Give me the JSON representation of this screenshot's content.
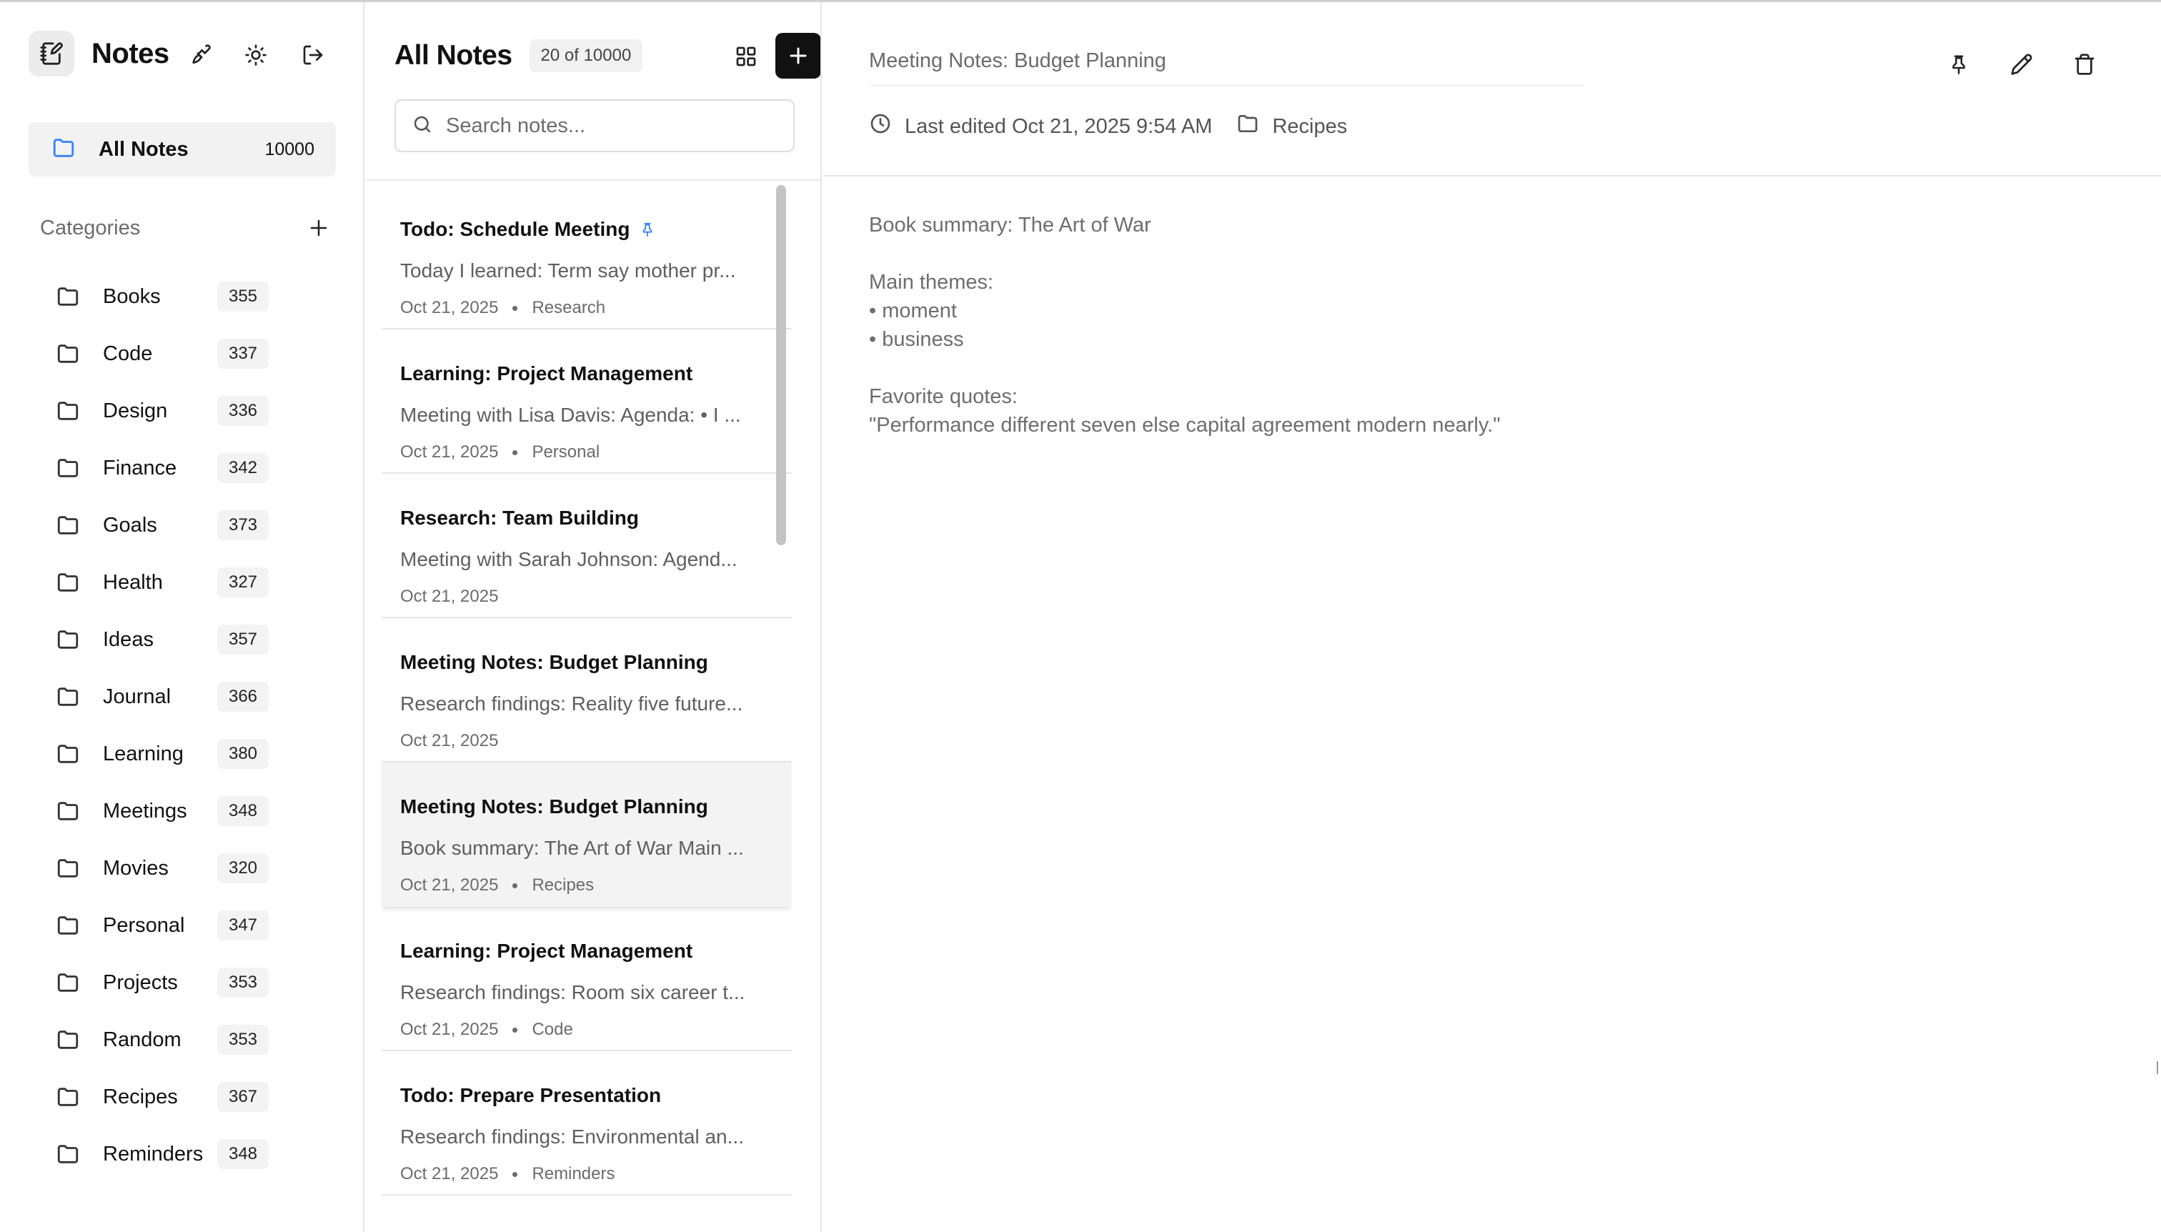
{
  "app": {
    "title": "Notes"
  },
  "sidebar": {
    "all_notes": {
      "label": "All Notes",
      "count": "10000"
    },
    "categories_title": "Categories",
    "categories": [
      {
        "name": "Books",
        "count": "355"
      },
      {
        "name": "Code",
        "count": "337"
      },
      {
        "name": "Design",
        "count": "336"
      },
      {
        "name": "Finance",
        "count": "342"
      },
      {
        "name": "Goals",
        "count": "373"
      },
      {
        "name": "Health",
        "count": "327"
      },
      {
        "name": "Ideas",
        "count": "357"
      },
      {
        "name": "Journal",
        "count": "366"
      },
      {
        "name": "Learning",
        "count": "380"
      },
      {
        "name": "Meetings",
        "count": "348"
      },
      {
        "name": "Movies",
        "count": "320"
      },
      {
        "name": "Personal",
        "count": "347"
      },
      {
        "name": "Projects",
        "count": "353"
      },
      {
        "name": "Random",
        "count": "353"
      },
      {
        "name": "Recipes",
        "count": "367"
      },
      {
        "name": "Reminders",
        "count": "348"
      }
    ]
  },
  "list": {
    "title": "All Notes",
    "count_label": "20 of 10000",
    "search_placeholder": "Search notes...",
    "notes": [
      {
        "title": "Todo: Schedule Meeting",
        "preview": "Today I learned: Term say mother pr...",
        "date": "Oct 21, 2025",
        "category": "Research",
        "pinned": true
      },
      {
        "title": "Learning: Project Management",
        "preview": "Meeting with Lisa Davis: Agenda: • I ...",
        "date": "Oct 21, 2025",
        "category": "Personal"
      },
      {
        "title": "Research: Team Building",
        "preview": "Meeting with Sarah Johnson: Agend...",
        "date": "Oct 21, 2025",
        "category": ""
      },
      {
        "title": "Meeting Notes: Budget Planning",
        "preview": "Research findings: Reality five future...",
        "date": "Oct 21, 2025",
        "category": ""
      },
      {
        "title": "Meeting Notes: Budget Planning",
        "preview": "Book summary: The Art of War Main ...",
        "date": "Oct 21, 2025",
        "category": "Recipes",
        "selected": true
      },
      {
        "title": "Learning: Project Management",
        "preview": "Research findings: Room six career t...",
        "date": "Oct 21, 2025",
        "category": "Code"
      },
      {
        "title": "Todo: Prepare Presentation",
        "preview": "Research findings: Environmental an...",
        "date": "Oct 21, 2025",
        "category": "Reminders"
      }
    ]
  },
  "editor": {
    "title": "Meeting Notes: Budget Planning",
    "last_edited": "Last edited Oct 21, 2025 9:54 AM",
    "category": "Recipes",
    "body": {
      "summary": "Book summary: The Art of War",
      "themes_heading": "Main themes:",
      "themes": [
        "• moment",
        "• business"
      ],
      "quotes_heading": "Favorite quotes:",
      "quote": "\"Performance different seven else capital agreement modern nearly.\""
    }
  },
  "colors": {
    "accent": "#111111",
    "pin": "#3b82f6",
    "folder_active": "#3b82f6"
  }
}
